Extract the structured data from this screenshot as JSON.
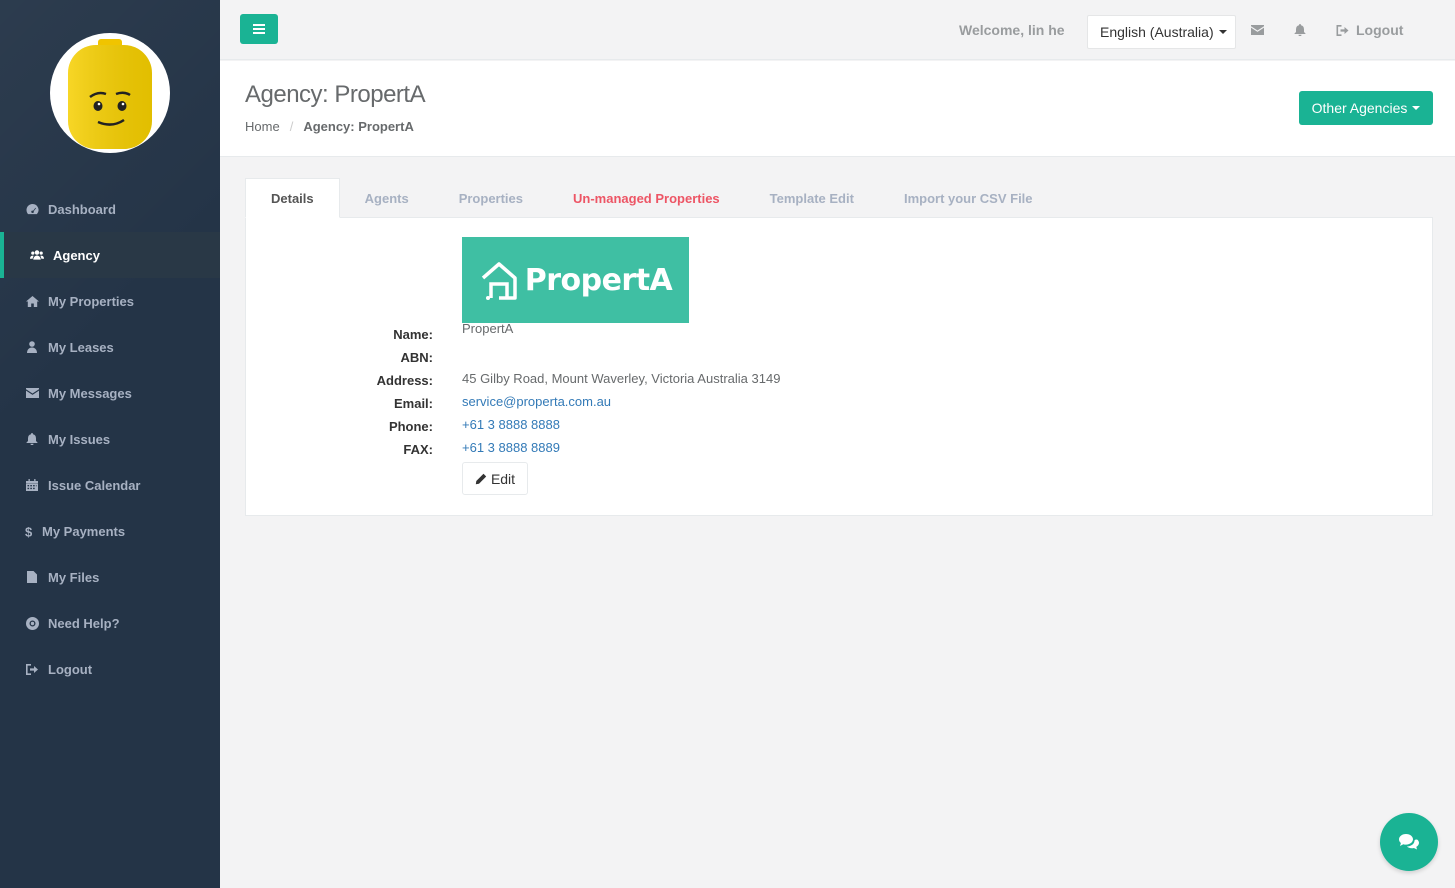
{
  "sidebar": {
    "items": [
      {
        "label": "Dashboard",
        "icon": "dashboard-icon"
      },
      {
        "label": "Agency",
        "icon": "users-icon"
      },
      {
        "label": "My Properties",
        "icon": "home-icon"
      },
      {
        "label": "My Leases",
        "icon": "user-icon"
      },
      {
        "label": "My Messages",
        "icon": "envelope-icon"
      },
      {
        "label": "My Issues",
        "icon": "bell-icon"
      },
      {
        "label": "Issue Calendar",
        "icon": "calendar-icon"
      },
      {
        "label": "My Payments",
        "icon": "dollar-icon"
      },
      {
        "label": "My Files",
        "icon": "file-icon"
      },
      {
        "label": "Need Help?",
        "icon": "life-ring-icon"
      },
      {
        "label": "Logout",
        "icon": "sign-out-icon"
      }
    ],
    "active": "Agency"
  },
  "topbar": {
    "welcome": "Welcome, lin he",
    "language": "English (Australia)",
    "logout": "Logout"
  },
  "header": {
    "title": "Agency: PropertA",
    "breadcrumb": [
      "Home",
      "Agency: PropertA"
    ],
    "other_agencies": "Other Agencies"
  },
  "tabs": [
    {
      "label": "Details"
    },
    {
      "label": "Agents"
    },
    {
      "label": "Properties"
    },
    {
      "label": "Un-managed Properties"
    },
    {
      "label": "Template Edit"
    },
    {
      "label": "Import your CSV File"
    }
  ],
  "details": {
    "logo_text": "PropertA",
    "fields": [
      {
        "label": "Name:",
        "value": "PropertA"
      },
      {
        "label": "ABN:",
        "value": ""
      },
      {
        "label": "Address:",
        "value": "45 Gilby Road, Mount Waverley, Victoria Australia 3149"
      },
      {
        "label": "Email:",
        "value": "service@properta.com.au"
      },
      {
        "label": "Phone:",
        "value": "+61 3 8888 8888"
      },
      {
        "label": "FAX:",
        "value": "+61 3 8888 8889"
      }
    ],
    "edit_label": "Edit"
  },
  "colors": {
    "accent": "#1ab394",
    "sidebar_bg": "#243447",
    "danger": "#ed5565",
    "link": "#337ab7"
  }
}
